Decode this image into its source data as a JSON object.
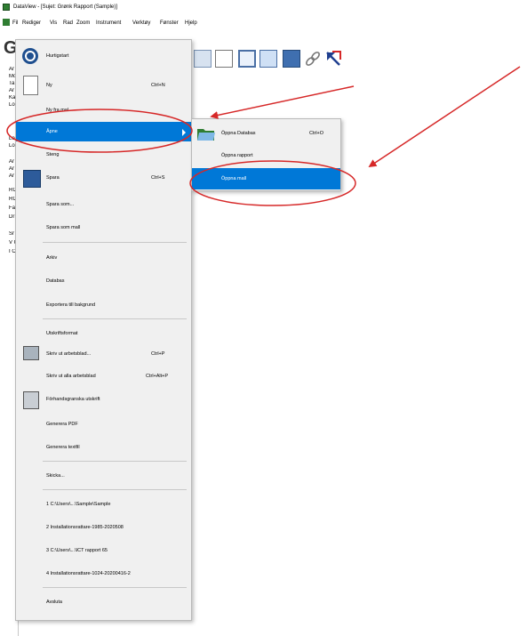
{
  "window": {
    "title": "DataView - [Sujet: Grønk Rapport (Sample)]"
  },
  "menubar": {
    "items": [
      "Fil",
      "Rediger",
      "Vis",
      "Rad",
      "Zoom",
      "Instrument",
      "Verktøy",
      "Fønster",
      "Hjelp"
    ]
  },
  "left_panel": {
    "rows": [
      "Ar",
      "Mo",
      "Ta",
      "Ar",
      "Ka",
      "Lo",
      "Lo",
      "Lo",
      "Ar",
      "Ar",
      "Ar",
      "RC",
      "RC",
      "Fa",
      "Dr",
      "Sr",
      "V C",
      "I O"
    ]
  },
  "file_menu": {
    "header": "Hurtigstart",
    "items": [
      {
        "label": "Ny",
        "shortcut": "Ctrl+N"
      },
      {
        "label": "Ny fra mal",
        "shortcut": ""
      },
      {
        "label": "Åpne",
        "shortcut": ""
      },
      {
        "label": "Steng",
        "shortcut": ""
      },
      {
        "label": "Spara",
        "shortcut": "Ctrl+S"
      },
      {
        "label": "Spara som...",
        "shortcut": ""
      },
      {
        "label": "Spara som mall",
        "shortcut": ""
      },
      {
        "label": "Arkiv",
        "shortcut": ""
      },
      {
        "label": "Databas",
        "shortcut": ""
      },
      {
        "label": "Exportera till bakgrund",
        "shortcut": ""
      },
      {
        "label": "Utskriftsformat",
        "shortcut": ""
      },
      {
        "label": "Skriv ut arbetsblad...",
        "shortcut": "Ctrl+P"
      },
      {
        "label": "Skriv ut alla arbetsblad",
        "shortcut": "Ctrl+Alt+P"
      },
      {
        "label": "Förhandsgranska utskrift",
        "shortcut": ""
      },
      {
        "label": "Generera PDF",
        "shortcut": ""
      },
      {
        "label": "Generera textfil",
        "shortcut": ""
      },
      {
        "label": "Skicka...",
        "shortcut": ""
      },
      {
        "label": "1 C:\\Users\\...\\Sample\\Sample",
        "shortcut": ""
      },
      {
        "label": "2 Installationsrattare-1985-2020508",
        "shortcut": ""
      },
      {
        "label": "3 C:\\Users\\...\\ICT rapport 65",
        "shortcut": ""
      },
      {
        "label": "4 Installationsrattare-1024-20200416-2",
        "shortcut": ""
      },
      {
        "label": "Avsluta",
        "shortcut": ""
      }
    ]
  },
  "submenu": {
    "items": [
      {
        "label": "Öppna Databas",
        "shortcut": "Ctrl+O"
      },
      {
        "label": "Öppna rapport",
        "shortcut": ""
      },
      {
        "label": "Öppna mall",
        "shortcut": ""
      }
    ]
  },
  "colors": {
    "highlight": "#0078d7",
    "annotation": "#d62828"
  }
}
